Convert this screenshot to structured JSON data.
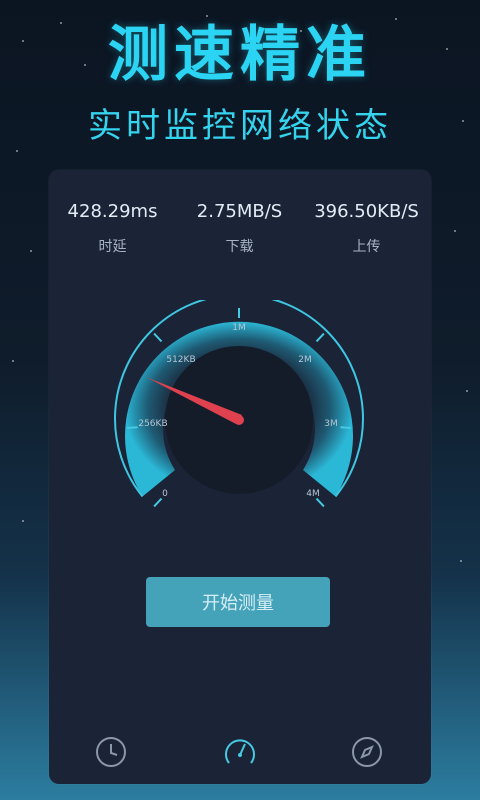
{
  "header": {
    "title": "测速精准",
    "subtitle": "实时监控网络状态"
  },
  "stats": [
    {
      "value": "428.29ms",
      "label": "时延"
    },
    {
      "value": "2.75MB/S",
      "label": "下载"
    },
    {
      "value": "396.50KB/S",
      "label": "上传"
    }
  ],
  "gauge": {
    "tick_labels": [
      "0",
      "256KB",
      "512KB",
      "1M",
      "2M",
      "3M",
      "4M"
    ],
    "needle_label": "512KB"
  },
  "start_button": {
    "label": "开始测量"
  },
  "bottom_nav": {
    "items": [
      {
        "icon": "clock-icon"
      },
      {
        "icon": "speedometer-icon"
      },
      {
        "icon": "compass-icon"
      }
    ]
  },
  "colors": {
    "accent": "#2ad4f2",
    "panel": "#1b2436",
    "button": "#44a2b9",
    "needle": "#e0414e"
  }
}
